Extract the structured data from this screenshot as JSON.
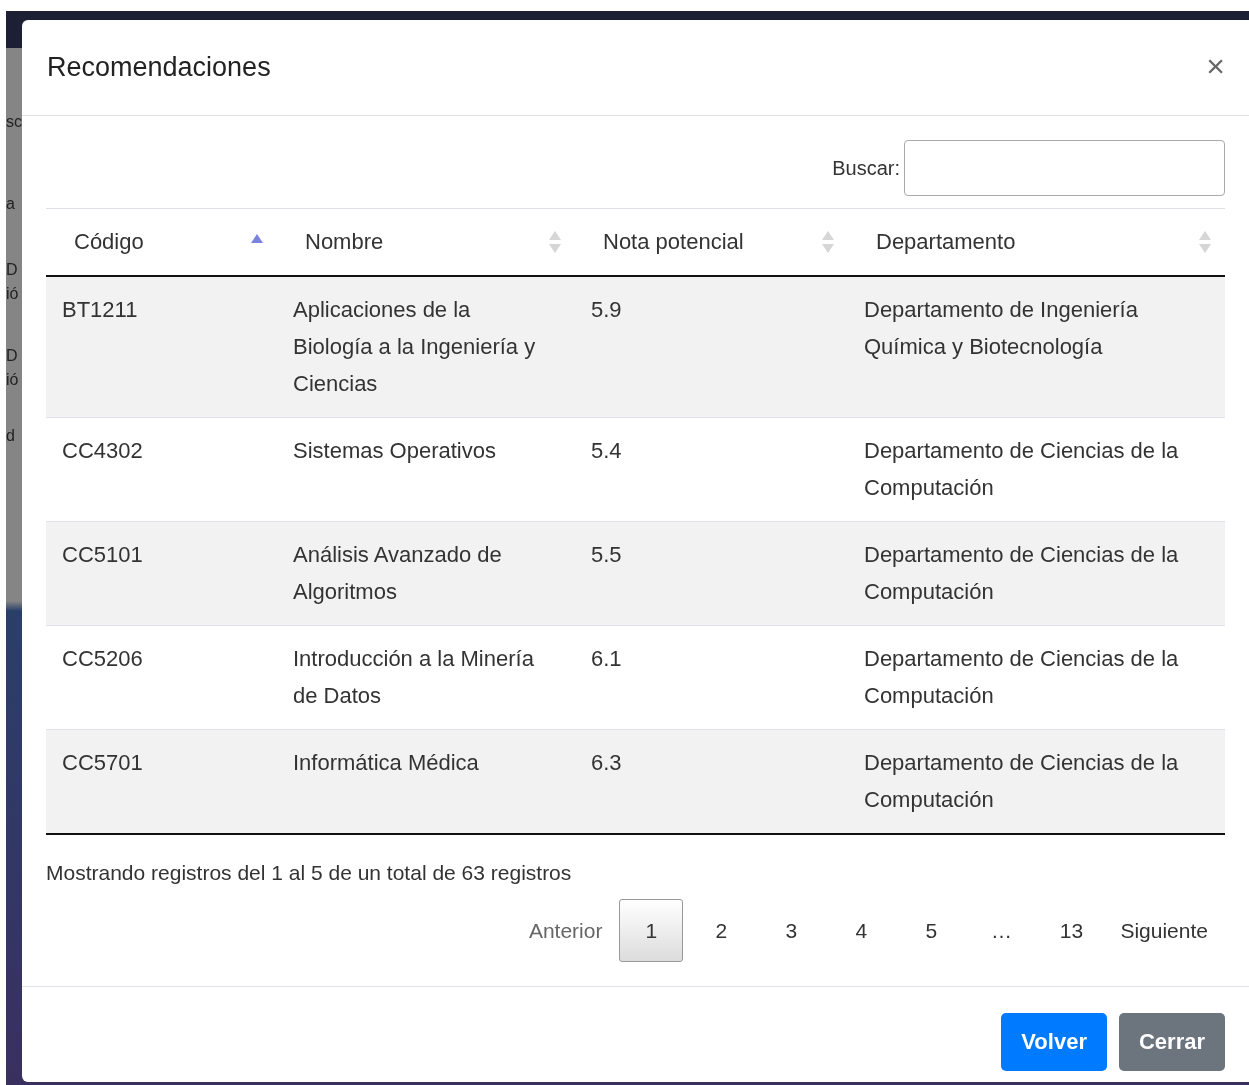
{
  "background": {
    "fragments": [
      "sc",
      "a",
      "D",
      "ió",
      "D",
      "ió",
      "d"
    ]
  },
  "modal": {
    "title": "Recomendaciones",
    "close": "×"
  },
  "search": {
    "label": "Buscar:"
  },
  "table": {
    "columns": [
      {
        "label": "Código",
        "sorted": true
      },
      {
        "label": "Nombre",
        "sorted": false
      },
      {
        "label": "Nota potencial",
        "sorted": false
      },
      {
        "label": "Departamento",
        "sorted": false
      }
    ],
    "rows": [
      [
        "BT1211",
        "Aplicaciones de la Biología a la Ingeniería y Ciencias",
        "5.9",
        "Departamento de Ingeniería Química y Biotecnología"
      ],
      [
        "CC4302",
        "Sistemas Operativos",
        "5.4",
        "Departamento de Ciencias de la Computación"
      ],
      [
        "CC5101",
        "Análisis Avanzado de Algoritmos",
        "5.5",
        "Departamento de Ciencias de la Computación"
      ],
      [
        "CC5206",
        "Introducción a la Minería de Datos",
        "6.1",
        "Departamento de Ciencias de la Computación"
      ],
      [
        "CC5701",
        "Informática Médica",
        "6.3",
        "Departamento de Ciencias de la Computación"
      ]
    ]
  },
  "info": "Mostrando registros del 1 al 5 de un total de 63 registros",
  "pagination": [
    {
      "label": "Anterior",
      "kind": "prev"
    },
    {
      "label": "1",
      "kind": "page",
      "selected": true
    },
    {
      "label": "2",
      "kind": "page",
      "selected": false
    },
    {
      "label": "3",
      "kind": "page",
      "selected": false
    },
    {
      "label": "4",
      "kind": "page",
      "selected": false
    },
    {
      "label": "5",
      "kind": "page",
      "selected": false
    },
    {
      "label": "…",
      "kind": "ellipsis"
    },
    {
      "label": "13",
      "kind": "page",
      "selected": false
    },
    {
      "label": "Siguiente",
      "kind": "next"
    }
  ],
  "buttons": [
    {
      "label": "Volver",
      "kind": "primary"
    },
    {
      "label": "Cerrar",
      "kind": "secondary"
    }
  ]
}
